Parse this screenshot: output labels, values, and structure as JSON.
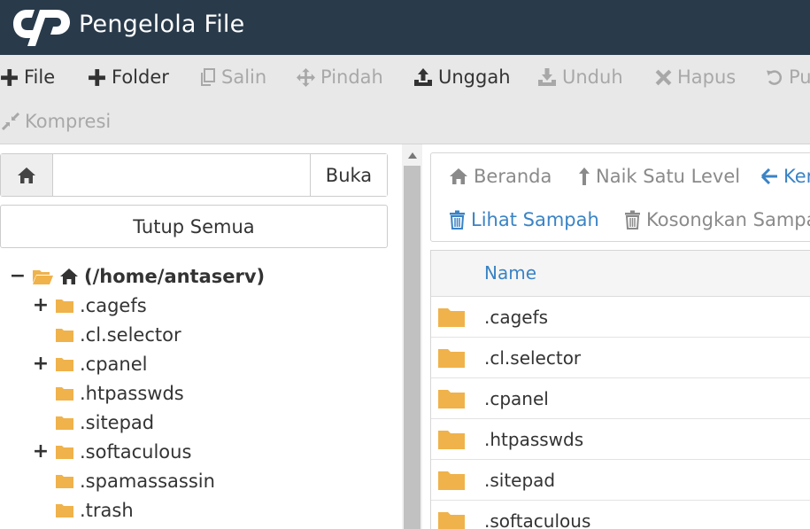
{
  "header": {
    "title": "Pengelola File",
    "logo_icon": "cpanel-logo-icon"
  },
  "toolbar": {
    "row1": [
      {
        "label": "File",
        "icon": "plus-icon",
        "enabled": true
      },
      {
        "label": "Folder",
        "icon": "plus-icon",
        "enabled": true
      },
      {
        "label": "Salin",
        "icon": "copy-icon",
        "enabled": false
      },
      {
        "label": "Pindah",
        "icon": "move-icon",
        "enabled": false
      },
      {
        "label": "Unggah",
        "icon": "upload-icon",
        "enabled": true
      },
      {
        "label": "Unduh",
        "icon": "download-icon",
        "enabled": false
      },
      {
        "label": "Hapus",
        "icon": "close-icon",
        "enabled": false
      },
      {
        "label": "Pu",
        "icon": "restore-icon",
        "enabled": false
      }
    ],
    "row2": [
      {
        "label": "Kompresi",
        "icon": "compress-icon",
        "enabled": false
      }
    ]
  },
  "path_bar": {
    "value": "",
    "go_label": "Buka"
  },
  "collapse_all_label": "Tutup Semua",
  "tree": {
    "root_label": "(/home/antaserv)",
    "items": [
      {
        "label": ".cagefs",
        "expandable": true
      },
      {
        "label": ".cl.selector",
        "expandable": false
      },
      {
        "label": ".cpanel",
        "expandable": true
      },
      {
        "label": ".htpasswds",
        "expandable": false
      },
      {
        "label": ".sitepad",
        "expandable": false
      },
      {
        "label": ".softaculous",
        "expandable": true
      },
      {
        "label": ".spamassassin",
        "expandable": false
      },
      {
        "label": ".trash",
        "expandable": false
      }
    ]
  },
  "nav": {
    "home": "Beranda",
    "up": "Naik Satu Level",
    "back": "Ker",
    "view_trash": "Lihat Sampah",
    "empty_trash": "Kosongkan Sampah"
  },
  "table": {
    "column_name": "Name",
    "rows": [
      {
        "name": ".cagefs"
      },
      {
        "name": ".cl.selector"
      },
      {
        "name": ".cpanel"
      },
      {
        "name": ".htpasswds"
      },
      {
        "name": ".sitepad"
      },
      {
        "name": ".softaculous"
      }
    ]
  },
  "colors": {
    "header_bg": "#293a4a",
    "toolbar_bg": "#e8e8e8",
    "folder": "#f0b24a",
    "link_blue": "#3a83c5",
    "disabled_text": "#a8a8a8"
  }
}
